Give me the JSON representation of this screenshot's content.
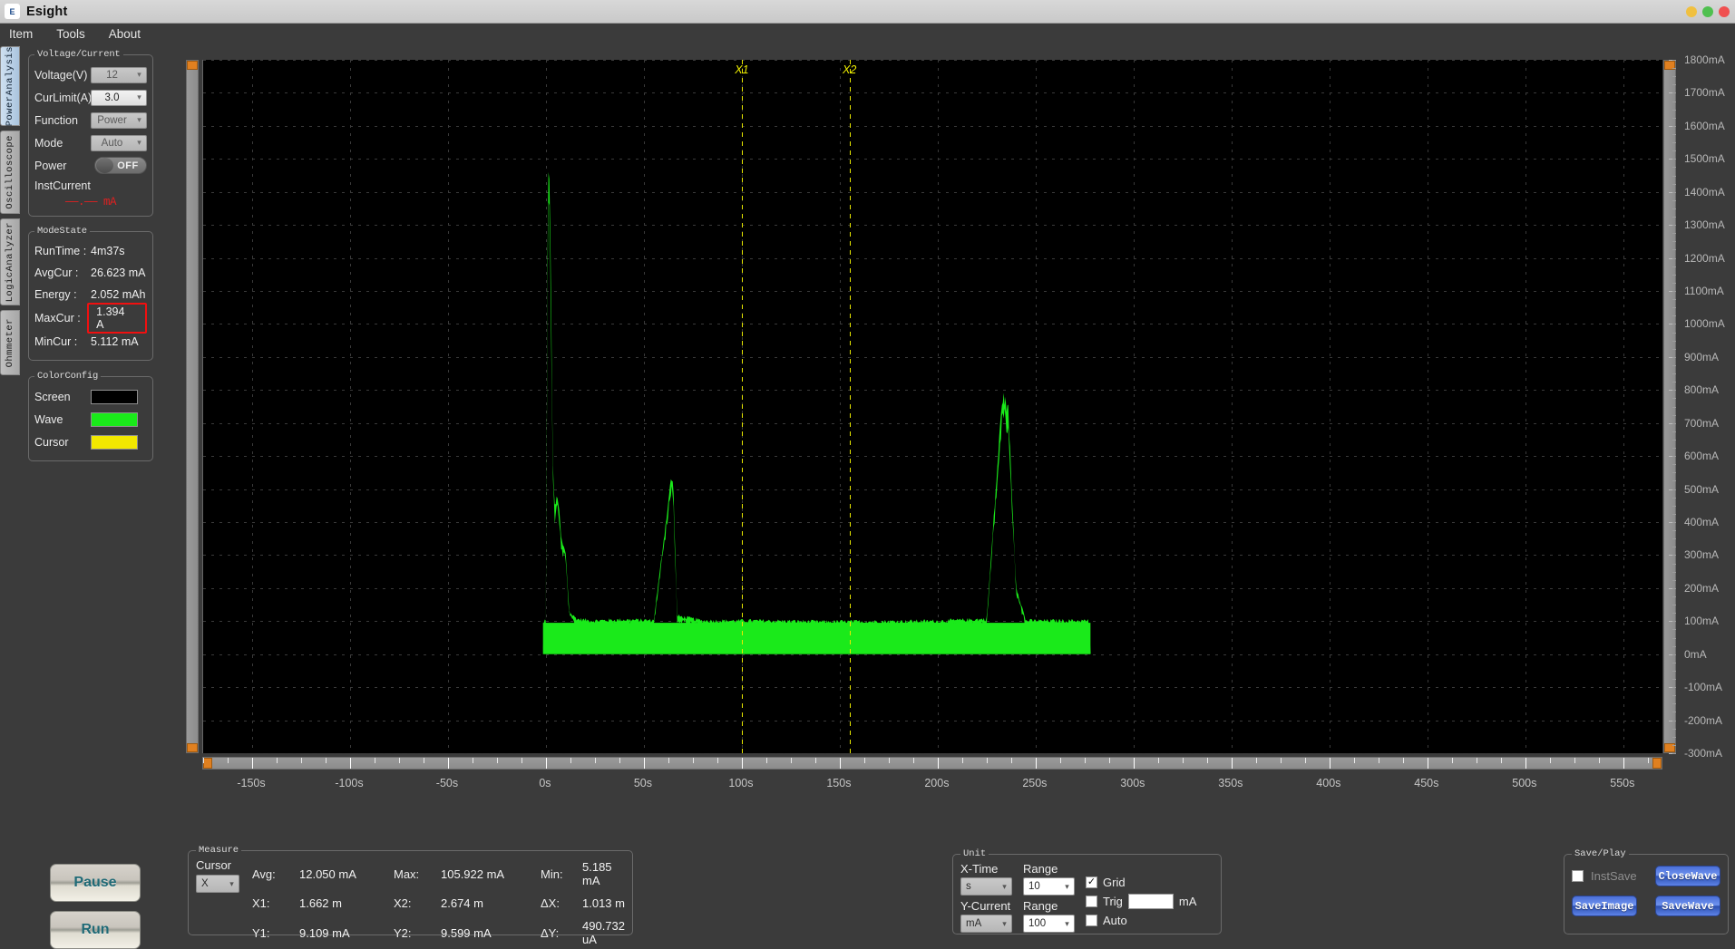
{
  "window": {
    "title": "Esight",
    "icon": "app-icon",
    "controls": [
      "minimize",
      "maximize",
      "close"
    ]
  },
  "menu": {
    "items": [
      {
        "label": "Item"
      },
      {
        "label": "Tools"
      },
      {
        "label": "About"
      }
    ]
  },
  "vtabs": {
    "items": [
      {
        "label": "PowerAnalysis",
        "selected": true
      },
      {
        "label": "Oscilloscope",
        "selected": false
      },
      {
        "label": "LogicAnalyzer",
        "selected": false
      },
      {
        "label": "Ohmmeter",
        "selected": false
      }
    ]
  },
  "voltage_current": {
    "legend": "Voltage/Current",
    "rows": [
      {
        "label": "Voltage(V)",
        "value": "12",
        "enabled": false
      },
      {
        "label": "CurLimit(A)",
        "value": "3.0",
        "enabled": true
      },
      {
        "label": "Function",
        "value": "Power",
        "enabled": false
      },
      {
        "label": "Mode",
        "value": "Auto",
        "enabled": false
      }
    ],
    "power_label": "Power",
    "power_state": "OFF",
    "inst_label": "InstCurrent",
    "inst_value": "——.—— mA"
  },
  "mode_state": {
    "legend": "ModeState",
    "rows": [
      {
        "label": "RunTime :",
        "value": "4m37s",
        "highlight": false
      },
      {
        "label": "AvgCur :",
        "value": "26.623 mA",
        "highlight": false
      },
      {
        "label": "Energy :",
        "value": "2.052 mAh",
        "highlight": false
      },
      {
        "label": "MaxCur :",
        "value": "1.394 A",
        "highlight": true
      },
      {
        "label": "MinCur :",
        "value": "5.112 mA",
        "highlight": false
      }
    ]
  },
  "color_config": {
    "legend": "ColorConfig",
    "rows": [
      {
        "label": "Screen",
        "color": "#000000"
      },
      {
        "label": "Wave",
        "color": "#1aea1a"
      },
      {
        "label": "Cursor",
        "color": "#f2e800"
      }
    ]
  },
  "actions": {
    "pause": "Pause",
    "run": "Run"
  },
  "measure": {
    "legend": "Measure",
    "cursor_label": "Cursor",
    "cursor_value": "X",
    "fields": [
      {
        "key": "Avg:",
        "value": "12.050 mA"
      },
      {
        "key": "Max:",
        "value": "105.922 mA"
      },
      {
        "key": "Min:",
        "value": "5.185 mA"
      },
      {
        "key": "X1:",
        "value": "1.662 m"
      },
      {
        "key": "X2:",
        "value": "2.674 m"
      },
      {
        "key": "ΔX:",
        "value": "1.013 m"
      },
      {
        "key": "Y1:",
        "value": "9.109 mA"
      },
      {
        "key": "Y2:",
        "value": "9.599 mA"
      },
      {
        "key": "ΔY:",
        "value": "490.732 uA"
      }
    ]
  },
  "unit": {
    "legend": "Unit",
    "x_time_label": "X-Time",
    "x_time_value": "s",
    "x_range_label": "Range",
    "x_range_value": "10",
    "y_current_label": "Y-Current",
    "y_current_value": "mA",
    "y_range_label": "Range",
    "y_range_value": "100",
    "grid_label": "Grid",
    "grid_checked": true,
    "trig_label": "Trig",
    "trig_checked": false,
    "trig_value": "",
    "trig_unit": "mA",
    "auto_label": "Auto",
    "auto_checked": false
  },
  "save_play": {
    "legend": "Save/Play",
    "inst_save_label": "InstSave",
    "inst_save_checked": false,
    "close_wave": "CloseWave",
    "save_image": "SaveImage",
    "save_wave": "SaveWave"
  },
  "chart_data": {
    "type": "line",
    "title": "",
    "xlabel": "",
    "ylabel": "",
    "xunit": "s",
    "yunit": "mA",
    "xlim": [
      -175,
      570
    ],
    "ylim": [
      -300,
      1800
    ],
    "xticks": [
      -150,
      -100,
      -50,
      0,
      50,
      100,
      150,
      200,
      250,
      300,
      350,
      400,
      450,
      500,
      550
    ],
    "xticklabels": [
      "-150s",
      "-100s",
      "-50s",
      "0s",
      "50s",
      "100s",
      "150s",
      "200s",
      "250s",
      "300s",
      "350s",
      "400s",
      "450s",
      "500s",
      "550s"
    ],
    "yticks": [
      1800,
      1700,
      1600,
      1500,
      1400,
      1300,
      1200,
      1100,
      1000,
      900,
      800,
      700,
      600,
      500,
      400,
      300,
      200,
      100,
      0,
      -100,
      -200,
      -300
    ],
    "yticklabels": [
      "1800mA",
      "1700mA",
      "1600mA",
      "1500mA",
      "1400mA",
      "1300mA",
      "1200mA",
      "1100mA",
      "1000mA",
      "900mA",
      "800mA",
      "700mA",
      "600mA",
      "500mA",
      "400mA",
      "300mA",
      "200mA",
      "100mA",
      "0mA",
      "-100mA",
      "-200mA",
      "-300mA"
    ],
    "grid": true,
    "legend_position": "none",
    "background": "#000000",
    "wave_color": "#1aea1a",
    "cursor_color": "#eded00",
    "cursors": [
      {
        "name": "X1",
        "x": 100
      },
      {
        "name": "X2",
        "x": 155
      }
    ],
    "series": [
      {
        "name": "Current",
        "points": [
          [
            -1.5,
            0
          ],
          [
            -1.0,
            95
          ],
          [
            0.0,
            100
          ],
          [
            1.0,
            1395
          ],
          [
            2.0,
            1390
          ],
          [
            3.5,
            560
          ],
          [
            4.5,
            430
          ],
          [
            6.0,
            470
          ],
          [
            8.0,
            330
          ],
          [
            10.0,
            300
          ],
          [
            12.0,
            120
          ],
          [
            16.0,
            100
          ],
          [
            24.0,
            95
          ],
          [
            40.0,
            98
          ],
          [
            55.0,
            96
          ],
          [
            64.0,
            520
          ],
          [
            65.0,
            500
          ],
          [
            67.0,
            110
          ],
          [
            80.0,
            95
          ],
          [
            110.0,
            95
          ],
          [
            140.0,
            92
          ],
          [
            170.0,
            93
          ],
          [
            200.0,
            94
          ],
          [
            225.0,
            100
          ],
          [
            233.0,
            760
          ],
          [
            236.0,
            720
          ],
          [
            240.0,
            200
          ],
          [
            245.0,
            95
          ],
          [
            260.0,
            95
          ],
          [
            277.0,
            95
          ],
          [
            278.0,
            0
          ]
        ],
        "baseline": 0,
        "noise_band": 12,
        "description": "Green filled current waveform with startup spike to ~1.39 A, secondary spikes at ~64s (~0.52 A) and ~233s (~0.76 A), idle plateau ~0.1 A."
      }
    ]
  }
}
